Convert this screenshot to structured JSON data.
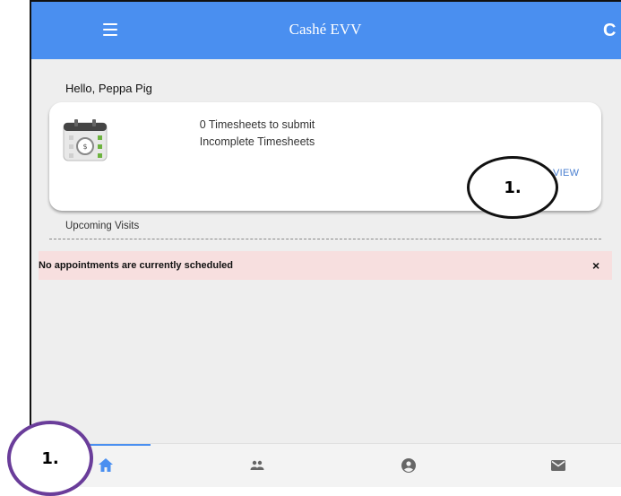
{
  "appbar": {
    "title": "Cashé EVV",
    "menu_icon": "hamburger-menu-icon",
    "refresh_icon": "refresh-icon"
  },
  "greeting": "Hello, Peppa Pig",
  "timesheet_card": {
    "icon": "calendar-icon",
    "line1": "0 Timesheets to submit",
    "line2": "Incomplete Timesheets",
    "view_label": "VIEW"
  },
  "upcoming_visits": {
    "label": "Upcoming Visits",
    "alert_text": "No appointments are currently scheduled",
    "close_glyph": "×"
  },
  "bottom_nav": {
    "items": [
      {
        "name": "home",
        "icon": "home-icon",
        "active": true
      },
      {
        "name": "people",
        "icon": "people-icon",
        "active": false
      },
      {
        "name": "profile",
        "icon": "account-icon",
        "active": false
      },
      {
        "name": "messages",
        "icon": "mail-icon",
        "active": false
      }
    ]
  },
  "annotations": {
    "callout_1": "1.",
    "callout_2": "1."
  },
  "colors": {
    "primary": "#4a8ff0",
    "alert_bg": "#f7dfdf",
    "callout_purple": "#6a3d9a"
  }
}
